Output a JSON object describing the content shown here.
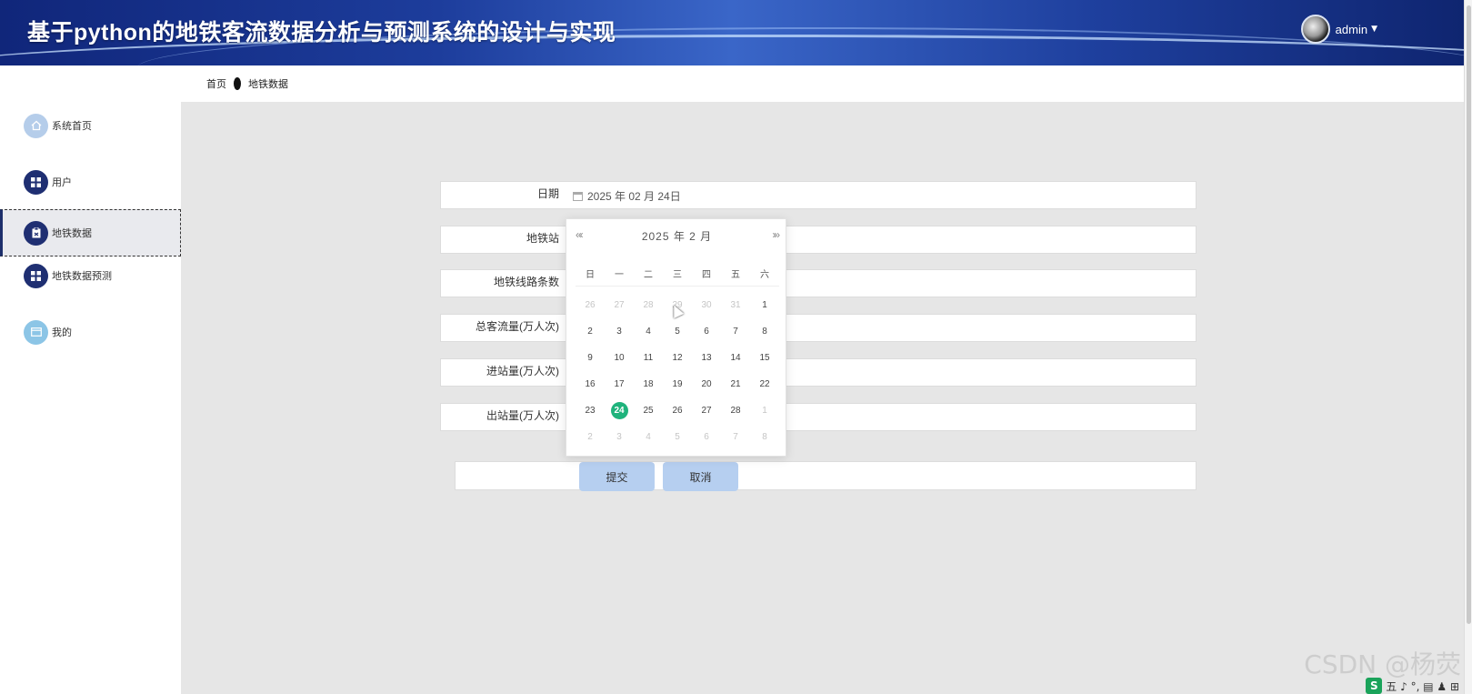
{
  "header": {
    "title": "基于python的地铁客流数据分析与预测系统的设计与实现",
    "user_name": "admin",
    "caret": "▼"
  },
  "breadcrumb": {
    "home": "首页",
    "current": "地铁数据"
  },
  "sidebar": {
    "items": [
      {
        "label": "系统首页",
        "icon": "home-icon"
      },
      {
        "label": "用户",
        "icon": "grid-icon"
      },
      {
        "label": "地铁数据",
        "icon": "clipboard-icon",
        "active": true
      },
      {
        "label": "地铁数据预测",
        "icon": "grid-icon"
      },
      {
        "label": "我的",
        "icon": "window-icon"
      }
    ]
  },
  "form": {
    "date_label": "日期",
    "date_value": "2025 年 02 月 24日",
    "station_label": "地铁站",
    "lines_label": "地铁线路条数",
    "total_label": "总客流量(万人次)",
    "in_label": "进站量(万人次)",
    "out_label": "出站量(万人次)",
    "submit": "提交",
    "cancel": "取消"
  },
  "datepicker": {
    "title": "2025 年  2 月",
    "prev": "«‹",
    "next": "›»",
    "weekdays": [
      "日",
      "一",
      "二",
      "三",
      "四",
      "五",
      "六"
    ],
    "days": [
      [
        "26",
        "27",
        "28",
        "29",
        "30",
        "31",
        "1"
      ],
      [
        "2",
        "3",
        "4",
        "5",
        "6",
        "7",
        "8"
      ],
      [
        "9",
        "10",
        "11",
        "12",
        "13",
        "14",
        "15"
      ],
      [
        "16",
        "17",
        "18",
        "19",
        "20",
        "21",
        "22"
      ],
      [
        "23",
        "24",
        "25",
        "26",
        "27",
        "28",
        "1"
      ],
      [
        "2",
        "3",
        "4",
        "5",
        "6",
        "7",
        "8"
      ]
    ],
    "selected": "24",
    "accent": "#1fb37c"
  },
  "overlay": {
    "watermark": "CSDN @杨荧",
    "tray": "五 ♪ °, ▤ ♟ ⊞"
  },
  "colors": {
    "header_bg": "#1d3d9c",
    "sidebar_icon_dark": "#1f2f72",
    "button_bg": "#b6cff0"
  }
}
